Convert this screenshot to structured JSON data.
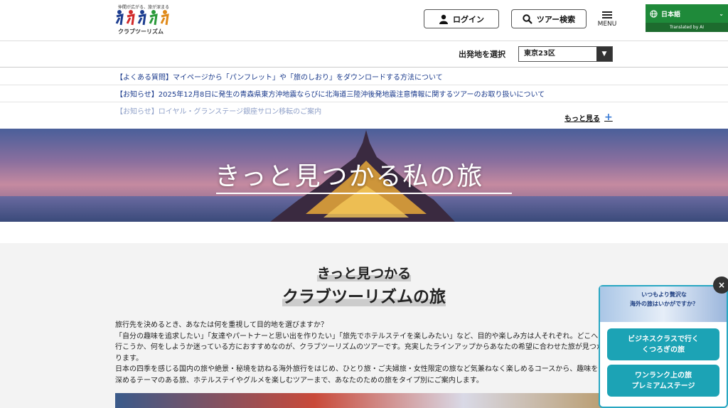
{
  "header": {
    "tagline": "仲間が広がる、旅が深まる",
    "brand": "クラブツーリズム",
    "login_label": "ログイン",
    "search_label": "ツアー検索",
    "menu_label": "MENU",
    "language": "日本語",
    "translated_by": "Translated by AI"
  },
  "origin": {
    "label": "出発地を選択",
    "selected": "東京23区"
  },
  "news": {
    "items": [
      "【よくある質問】マイページから「パンフレット」や「旅のしおり」をダウンロードする方法について",
      "【お知らせ】2025年12月8日に発生の青森県東方沖地震ならびに北海道三陸沖後発地震注意情報に関するツアーのお取り扱いについて",
      "【お知らせ】ロイヤル・グランステージ銀座サロン移転のご案内"
    ],
    "more_label": "もっと見る"
  },
  "hero": {
    "title": "きっと見つかる私の旅"
  },
  "content": {
    "heading1": "きっと見つかる",
    "heading2": "クラブツーリズムの旅",
    "paragraph": [
      "旅行先を決めるとき、あなたは何を重視して目的地を選びますか？",
      "「自分の趣味を追求したい」「友達やパートナーと思い出を作りたい」「旅先でホテルステイを楽しみたい」など、目的や楽しみ方は人それぞれ。どこへ",
      "行こうか、何をしようか迷っている方におすすめなのが、クラブツーリズムのツアーです。充実したラインアップからあなたの希望に合わせた旅が見つか",
      "ります。",
      "日本の四季を感じる国内の旅や絶景・秘境を訪ねる海外旅行をはじめ、ひとり旅・ご夫婦旅・女性限定の旅など気兼ねなく楽しめるコースから、趣味を",
      "深めるテーマのある旅、ホテルステイやグルメを楽しむツアーまで、あなたのための旅をタイプ別にご案内します。"
    ]
  },
  "popup": {
    "image_text_1": "いつもより贅沢な",
    "image_text_2": "海外の旅はいかがですか？",
    "button1_line1": "ビジネスクラスで行く",
    "button1_line2": "くつろぎの旅",
    "button2_line1": "ワンランク上の旅",
    "button2_line2": "プレミアムステージ",
    "close_label": "×"
  },
  "colors": {
    "translate_bg": "#1f8a3a",
    "news_link": "#1a3a8c",
    "popup_accent": "#1ca3b5",
    "plus_icon": "#3a7bd5"
  }
}
